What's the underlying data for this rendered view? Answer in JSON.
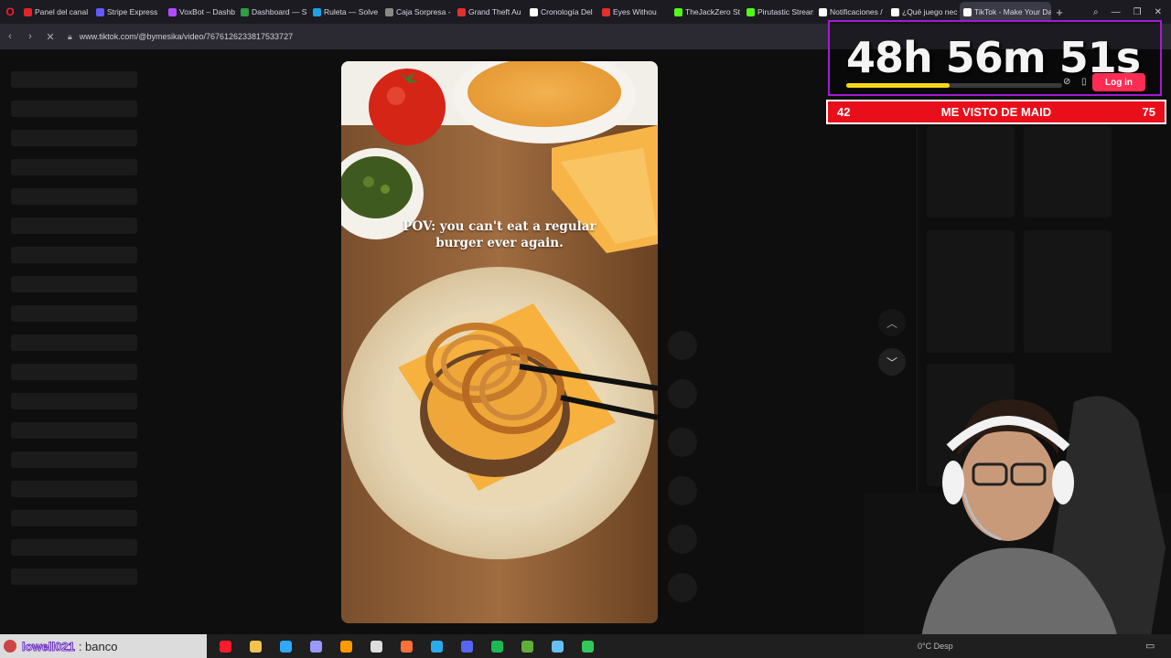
{
  "browser": {
    "tabs": [
      {
        "label": "Panel del canal",
        "color": "#e3242b"
      },
      {
        "label": "Stripe Express",
        "color": "#635bff"
      },
      {
        "label": "VoxBot – Dashb",
        "color": "#b04cff"
      },
      {
        "label": "Dashboard — S",
        "color": "#2f9e44"
      },
      {
        "label": "Ruleta — Solve",
        "color": "#1aa3e8"
      },
      {
        "label": "Caja Sorpresa -",
        "color": "#888888"
      },
      {
        "label": "Grand Theft Au",
        "color": "#e03131"
      },
      {
        "label": "Cronología Del",
        "color": "#ffffff"
      },
      {
        "label": "Eyes Withou",
        "color": "#e03131"
      },
      {
        "label": "TheJackZero St",
        "color": "#53fc18"
      },
      {
        "label": "Pirutastic Stream",
        "color": "#53fc18"
      },
      {
        "label": "Notificaciones /",
        "color": "#ffffff"
      },
      {
        "label": "¿Qué juego nec",
        "color": "#ffffff"
      },
      {
        "label": "TikTok - Make Your Da",
        "color": "#ffffff",
        "active": true
      }
    ],
    "new_tab_icon": "plus-icon",
    "url": "www.tiktok.com/@bymesika/video/7676126233817533727"
  },
  "video": {
    "caption_line1": "POV: you can't eat a regular",
    "caption_line2": "burger ever again."
  },
  "overlay": {
    "timer": "48h 56m 51s",
    "progress": 0.48,
    "login_label": "Log in"
  },
  "vote": {
    "left_value": "42",
    "title": "ME VISTO DE MAID",
    "right_value": "75"
  },
  "taskbar": {
    "user_name": "lowell021",
    "user_message": ": banco",
    "weather": "0°C  Desp",
    "apps": [
      {
        "name": "opera-icon",
        "color": "#ff1b2d"
      },
      {
        "name": "folder-icon",
        "color": "#f2c14e"
      },
      {
        "name": "photoshop-icon",
        "color": "#31a8ff"
      },
      {
        "name": "premiere-icon",
        "color": "#9999ff"
      },
      {
        "name": "illustrator-icon",
        "color": "#ff9a00"
      },
      {
        "name": "obs-icon",
        "color": "#dddddd"
      },
      {
        "name": "firefox-icon",
        "color": "#ff7139"
      },
      {
        "name": "telegram-icon",
        "color": "#2aabee"
      },
      {
        "name": "discord-icon",
        "color": "#5865f2"
      },
      {
        "name": "spotify-icon",
        "color": "#1db954"
      },
      {
        "name": "minecraft-icon",
        "color": "#5fae3a"
      },
      {
        "name": "steam-icon",
        "color": "#66c0f4"
      },
      {
        "name": "cube-icon",
        "color": "#34c759"
      }
    ]
  }
}
